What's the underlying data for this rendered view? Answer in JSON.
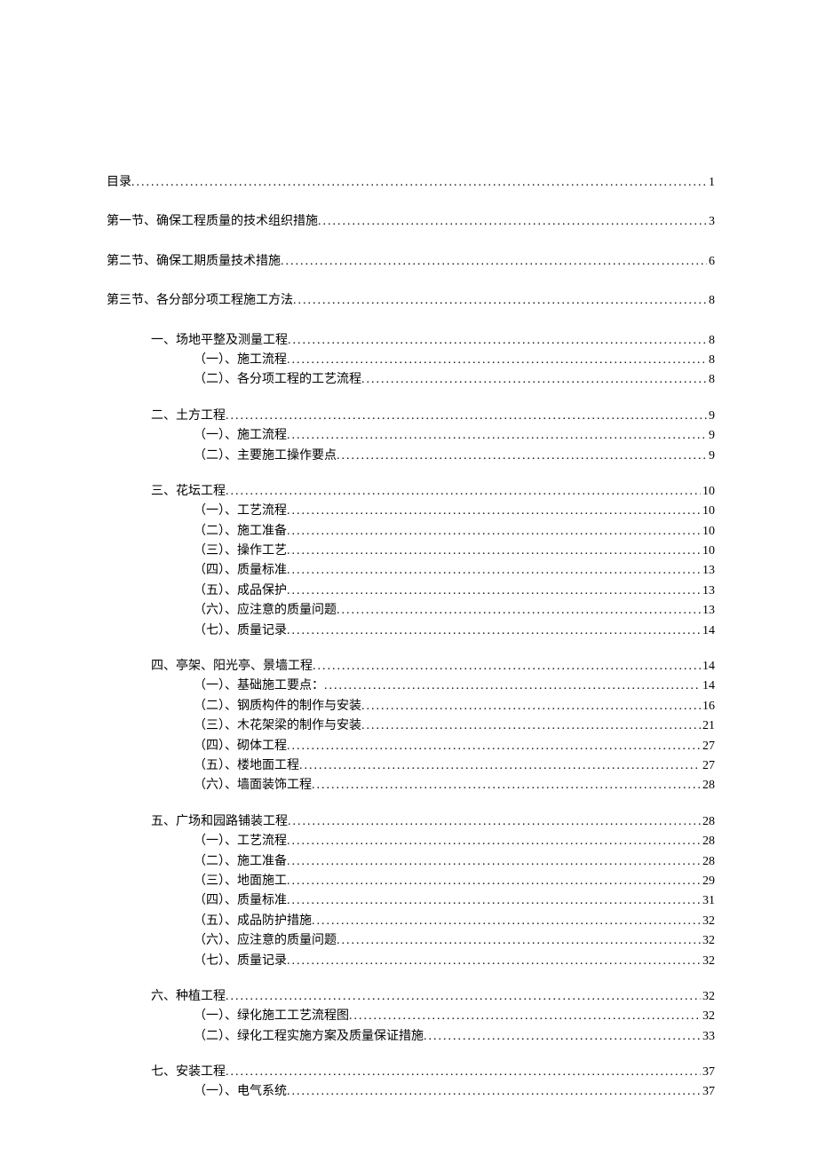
{
  "toc": [
    {
      "level": 0,
      "label": "目录",
      "page": "1",
      "gap": false
    },
    {
      "level": 0,
      "label": "第一节、确保工程质量的技术组织措施",
      "page": "3",
      "gap": false
    },
    {
      "level": 0,
      "label": "第二节、确保工期质量技术措施",
      "page": "6",
      "gap": false
    },
    {
      "level": 0,
      "label": "第三节、各分部分项工程施工方法",
      "page": "8",
      "gap": false
    },
    {
      "level": 1,
      "label": "一、场地平整及测量工程",
      "page": "8",
      "gap": false
    },
    {
      "level": 2,
      "label": "（一）、施工流程",
      "page": "8",
      "gap": false
    },
    {
      "level": 2,
      "label": "（二）、各分项工程的工艺流程",
      "page": "8",
      "gap": false
    },
    {
      "level": 1,
      "label": "二、土方工程",
      "page": "9",
      "gap": true
    },
    {
      "level": 2,
      "label": "（一）、施工流程",
      "page": "9",
      "gap": false
    },
    {
      "level": 2,
      "label": "（二）、主要施工操作要点",
      "page": "9",
      "gap": false
    },
    {
      "level": 1,
      "label": "三、花坛工程",
      "page": "10",
      "gap": true
    },
    {
      "level": 2,
      "label": "（一）、工艺流程",
      "page": "10",
      "gap": false
    },
    {
      "level": 2,
      "label": "（二）、施工准备",
      "page": "10",
      "gap": false
    },
    {
      "level": 2,
      "label": "（三）、操作工艺",
      "page": "10",
      "gap": false
    },
    {
      "level": 2,
      "label": "（四）、质量标准",
      "page": "13",
      "gap": false
    },
    {
      "level": 2,
      "label": "（五）、成品保护",
      "page": "13",
      "gap": false
    },
    {
      "level": 2,
      "label": "（六）、应注意的质量问题",
      "page": "13",
      "gap": false
    },
    {
      "level": 2,
      "label": "（七）、质量记录",
      "page": "14",
      "gap": false
    },
    {
      "level": 1,
      "label": "四、亭架、阳光亭、景墙工程",
      "page": "14",
      "gap": true
    },
    {
      "level": 2,
      "label": "（一）、基础施工要点：",
      "page": "14",
      "gap": false
    },
    {
      "level": 2,
      "label": "（二）、钢质构件的制作与安装",
      "page": "16",
      "gap": false
    },
    {
      "level": 2,
      "label": "（三）、木花架梁的制作与安装",
      "page": "21",
      "gap": false
    },
    {
      "level": 2,
      "label": "（四）、砌体工程",
      "page": "27",
      "gap": false
    },
    {
      "level": 2,
      "label": "（五）、楼地面工程",
      "page": "27",
      "gap": false
    },
    {
      "level": 2,
      "label": "（六）、墙面装饰工程",
      "page": "28",
      "gap": false
    },
    {
      "level": 1,
      "label": "五、广场和园路铺装工程",
      "page": "28",
      "gap": true
    },
    {
      "level": 2,
      "label": "（一）、工艺流程",
      "page": "28",
      "gap": false
    },
    {
      "level": 2,
      "label": "（二）、施工准备",
      "page": "28",
      "gap": false
    },
    {
      "level": 2,
      "label": "（三）、地面施工",
      "page": "29",
      "gap": false
    },
    {
      "level": 2,
      "label": "（四）、质量标准",
      "page": "31",
      "gap": false
    },
    {
      "level": 2,
      "label": "（五）、成品防护措施",
      "page": "32",
      "gap": false
    },
    {
      "level": 2,
      "label": "（六）、应注意的质量问题",
      "page": "32",
      "gap": false
    },
    {
      "level": 2,
      "label": "（七）、质量记录",
      "page": "32",
      "gap": false
    },
    {
      "level": 1,
      "label": "六、种植工程",
      "page": "32",
      "gap": true
    },
    {
      "level": 2,
      "label": "（一）、绿化施工工艺流程图",
      "page": "32",
      "gap": false
    },
    {
      "level": 2,
      "label": "（二）、绿化工程实施方案及质量保证措施",
      "page": "33",
      "gap": false
    },
    {
      "level": 1,
      "label": "七、安装工程",
      "page": "37",
      "gap": true
    },
    {
      "level": 2,
      "label": "（一）、电气系统",
      "page": "37",
      "gap": false
    }
  ]
}
